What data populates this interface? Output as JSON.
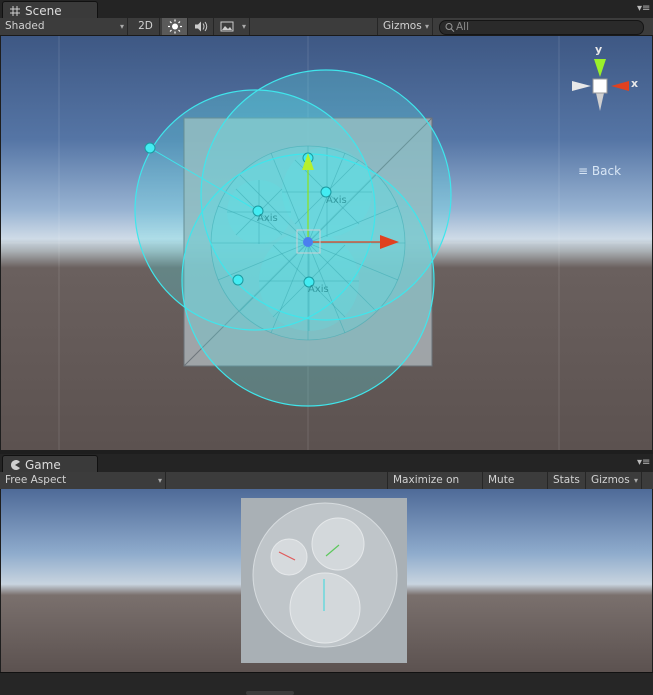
{
  "scene_tab": {
    "label": "Scene",
    "icon": "grid-icon"
  },
  "scene_toolbar": {
    "shading_mode": "Shaded",
    "mode_2d": "2D",
    "lighting_icon": "sun-icon",
    "audio_icon": "speaker-icon",
    "effects_icon": "image-icon",
    "gizmos_label": "Gizmos",
    "search_placeholder": "All"
  },
  "scene_view": {
    "orientation_axes": {
      "y": "y",
      "x": "x"
    },
    "orientation_label": "Back",
    "axis_labels": [
      "Axis",
      "Axis",
      "Axis"
    ],
    "colors": {
      "sky_top": "#3f5a86",
      "horizon": "#c9d6e3",
      "ground": "#5b5150",
      "gizmo_cyan": "#3fe0e6",
      "move_y": "#8ae22b",
      "move_x": "#e0411f"
    }
  },
  "game_tab": {
    "label": "Game",
    "icon": "pacman-icon"
  },
  "game_toolbar": {
    "aspect": "Free Aspect",
    "maximize_on_play": "Maximize on Play",
    "mute_audio": "Mute audio",
    "stats": "Stats",
    "gizmos_label": "Gizmos"
  }
}
